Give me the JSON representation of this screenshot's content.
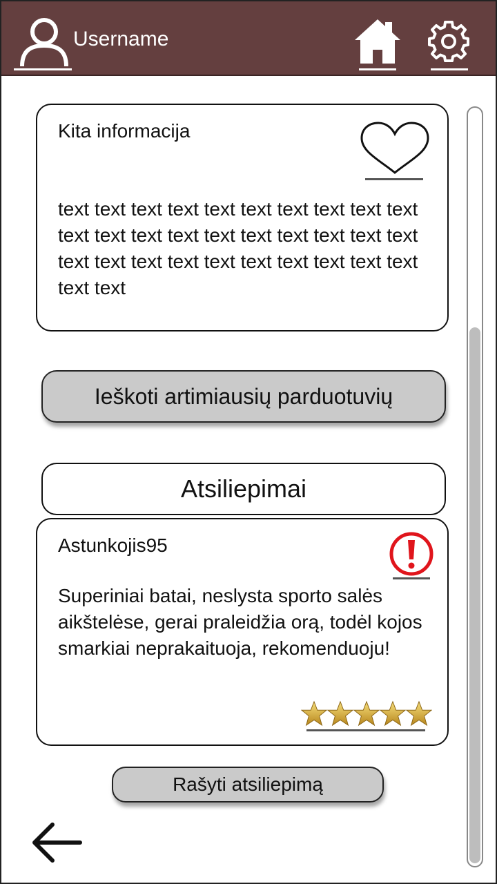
{
  "header": {
    "username": "Username",
    "background_color": "#643f3f",
    "icons": [
      "user-icon",
      "home-icon",
      "gear-icon"
    ]
  },
  "info_card": {
    "title": "Kita informacija",
    "body": "text text text text text text text text text text text text text text text text text text text text text text text text text text text text text text text text",
    "icon": "heart-icon"
  },
  "search_button": {
    "label": "Ieškoti artimiausių parduotuvių"
  },
  "reviews": {
    "header": "Atsiliepimai",
    "items": [
      {
        "author": "Astunkojis95",
        "text": "Superiniai batai, neslysta sporto salės aikštelėse, gerai praleidžia orą, todėl kojos smarkiai neprakaituoja, rekomenduoju!",
        "rating": 5,
        "rating_max": 5,
        "report_icon": "alert-icon",
        "report_color": "#e0151c"
      }
    ],
    "write_label": "Rašyti atsiliepimą"
  },
  "navigation": {
    "back_icon": "arrow-left-icon"
  }
}
